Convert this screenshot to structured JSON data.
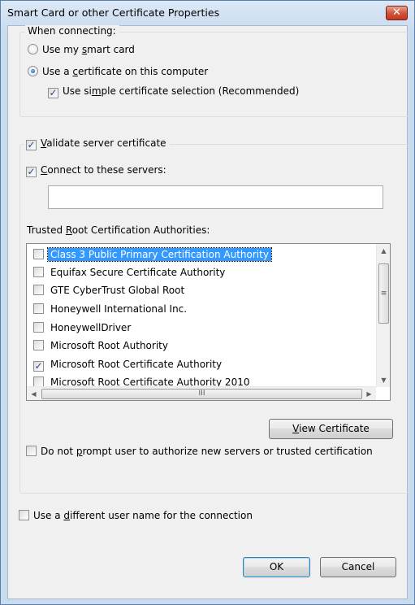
{
  "window": {
    "title": "Smart Card or other Certificate Properties",
    "close_glyph": "✕"
  },
  "connecting": {
    "legend": "When connecting:",
    "options": [
      {
        "pre": "Use my ",
        "key": "s",
        "post": "mart card",
        "selected": false
      },
      {
        "pre": "Use a ",
        "key": "c",
        "post": "ertificate on this computer",
        "selected": true
      }
    ],
    "simple_selection": {
      "pre": "Use si",
      "key": "m",
      "post": "ple certificate selection (Recommended)",
      "checked": true
    }
  },
  "validate": {
    "legend": {
      "pre": "",
      "key": "V",
      "post": "alidate server certificate",
      "checked": true
    },
    "connect_servers": {
      "pre": "",
      "key": "C",
      "post": "onnect to these servers:",
      "checked": true
    },
    "servers_value": "",
    "trusted_label": {
      "pre": "Trusted ",
      "key": "R",
      "post": "oot Certification Authorities:"
    },
    "authorities": [
      {
        "name": "Class 3 Public Primary Certification Authority",
        "checked": false,
        "selected": true
      },
      {
        "name": "Equifax Secure Certificate Authority",
        "checked": false,
        "selected": false
      },
      {
        "name": "GTE CyberTrust Global Root",
        "checked": false,
        "selected": false
      },
      {
        "name": "Honeywell International Inc.",
        "checked": false,
        "selected": false
      },
      {
        "name": "HoneywellDriver",
        "checked": false,
        "selected": false
      },
      {
        "name": "Microsoft Root Authority",
        "checked": false,
        "selected": false
      },
      {
        "name": "Microsoft Root Certificate Authority",
        "checked": true,
        "selected": false
      },
      {
        "name": "Microsoft Root Certificate Authority 2010",
        "checked": false,
        "selected": false
      }
    ],
    "view_certificate": {
      "pre": "",
      "key": "V",
      "post": "iew Certificate"
    },
    "no_prompt": {
      "pre": "Do not ",
      "key": "p",
      "post": "rompt user to authorize new servers or trusted certification",
      "checked": false
    }
  },
  "different_user": {
    "pre": "Use a ",
    "key": "d",
    "post": "ifferent user name for the connection",
    "checked": false
  },
  "buttons": {
    "ok": "OK",
    "cancel": "Cancel"
  },
  "scroll": {
    "up": "▲",
    "down": "▼",
    "left": "◀",
    "right": "▶",
    "grip_v": "≡",
    "grip_h": "III"
  },
  "colors": {
    "selection": "#3399ff",
    "close_button": "#c13a20"
  }
}
